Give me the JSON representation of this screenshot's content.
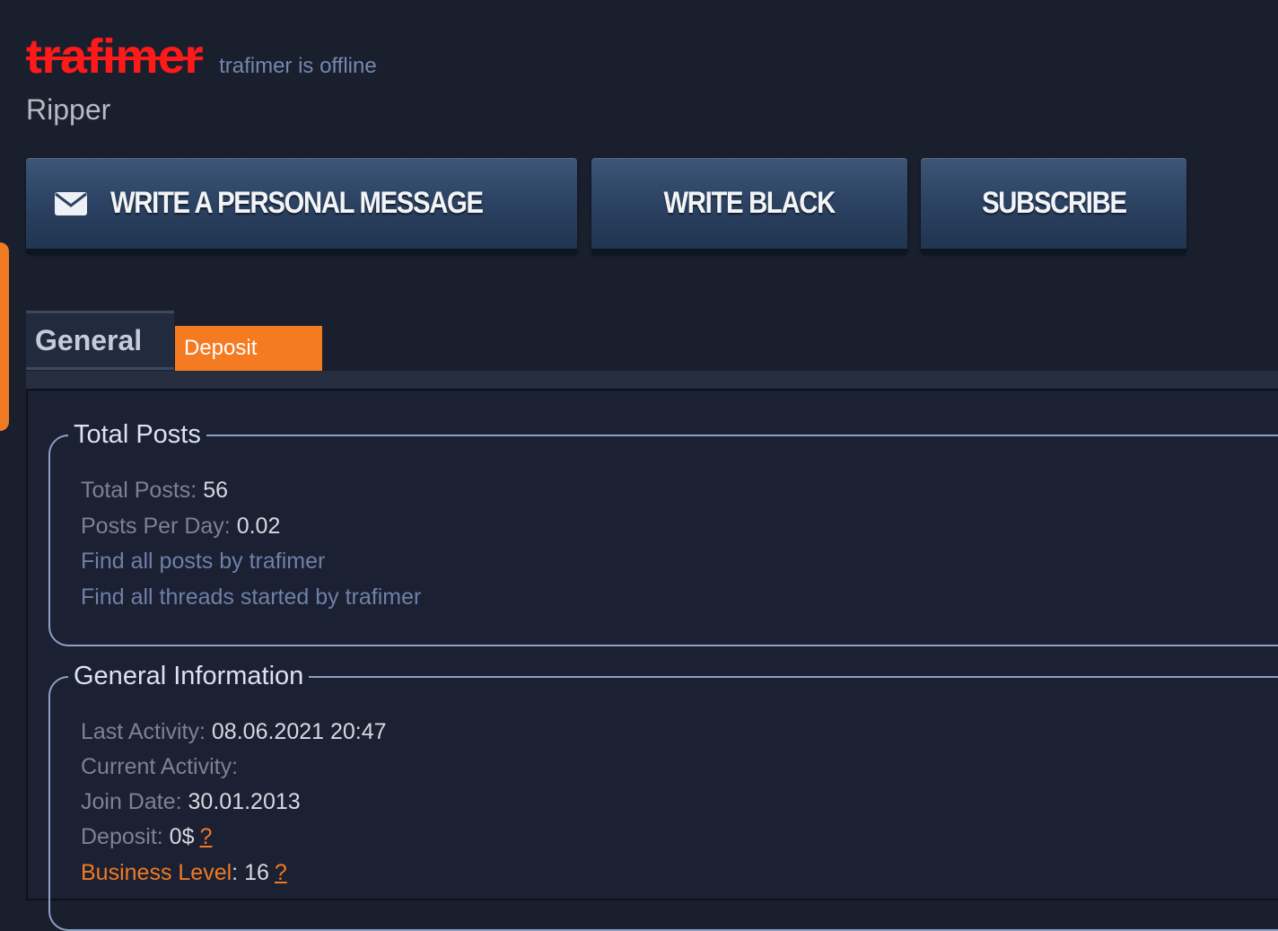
{
  "profile": {
    "username": "trafimer",
    "status_text": "trafimer is offline",
    "usertitle": "Ripper"
  },
  "actions": {
    "pm_label": "WRITE A PERSONAL MESSAGE",
    "black_label": "WRITE BLACK",
    "subscribe_label": "SUBSCRIBE",
    "pm_icon": "envelope-icon"
  },
  "tabs": [
    {
      "label": "General",
      "active": true
    },
    {
      "label": "Deposit",
      "active": false
    }
  ],
  "total_posts": {
    "legend": "Total Posts",
    "total_label": "Total Posts",
    "total_value": "56",
    "per_day_label": "Posts Per Day",
    "per_day_value": "0.02",
    "find_posts": "Find all posts by trafimer",
    "find_threads": "Find all threads started by trafimer"
  },
  "general_info": {
    "legend": "General Information",
    "last_activity_label": "Last Activity",
    "last_activity_value": "08.06.2021 20:47",
    "current_activity_label": "Current Activity",
    "join_date_label": "Join Date",
    "join_date_value": "30.01.2013",
    "deposit_label": "Deposit",
    "deposit_value": "0$",
    "deposit_help": "?",
    "business_level_label": "Business Level",
    "business_level_value": "16",
    "business_level_help": "?"
  },
  "colors": {
    "background": "#1a1f2e",
    "username_red": "#ff1a1a",
    "accent_orange": "#f47b22",
    "button_blue": "#2c4262",
    "fieldset_border": "#8d9fc4"
  }
}
